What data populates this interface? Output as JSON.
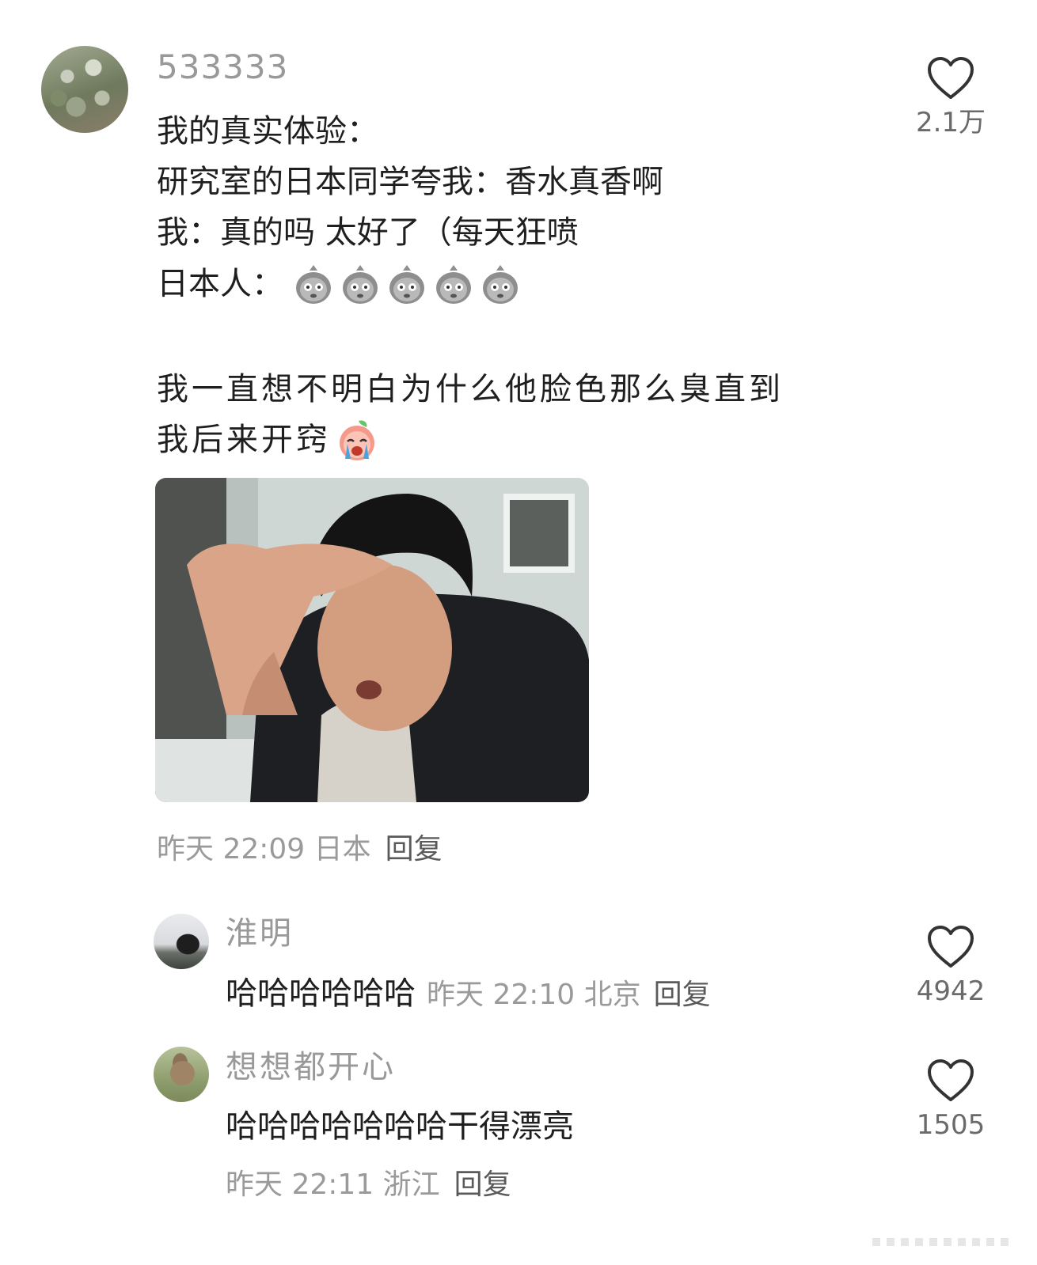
{
  "main_comment": {
    "username": "533333",
    "lines": [
      "我的真实体验：",
      "研究室的日本同学夸我：香水真香啊",
      "我：真的吗 太好了（每天狂喷",
      "日本人：",
      "我一直想不明白为什么他脸色那么臭直到",
      "我后来开窍"
    ],
    "meta": "昨天 22:09 日本",
    "reply_label": "回复",
    "likes": "2.1万"
  },
  "replies": [
    {
      "username": "淮明",
      "text": "哈哈哈哈哈哈",
      "meta": "昨天 22:10 北京",
      "reply_label": "回复",
      "likes": "4942"
    },
    {
      "username": "想想都开心",
      "text": "哈哈哈哈哈哈哈干得漂亮",
      "meta": "昨天 22:11 浙江",
      "reply_label": "回复",
      "likes": "1505"
    }
  ]
}
